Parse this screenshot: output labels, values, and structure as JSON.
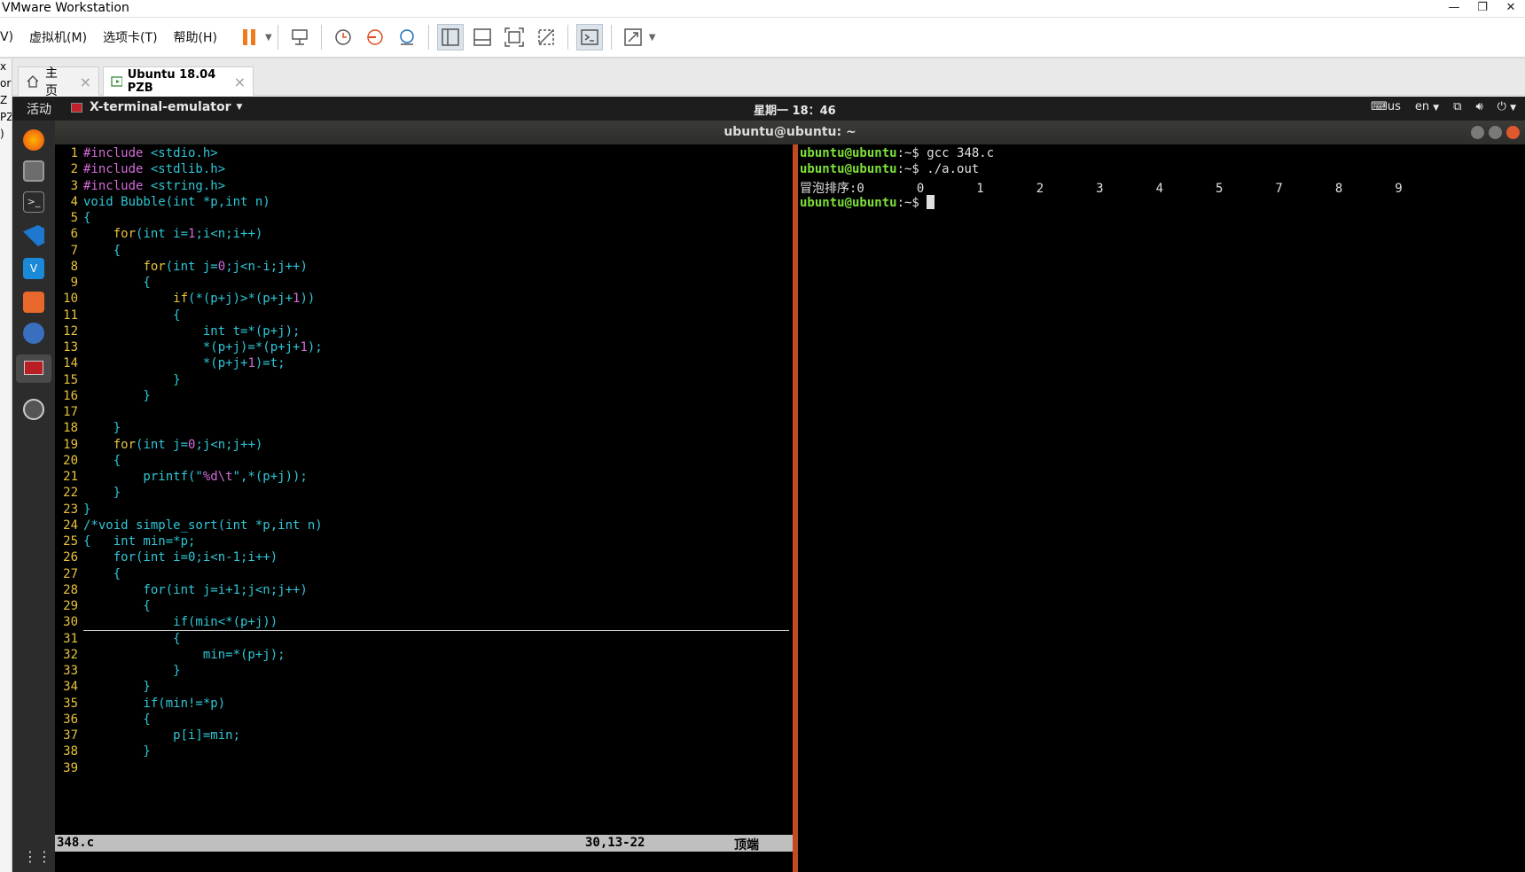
{
  "window": {
    "title": "VMware Workstation"
  },
  "menus": [
    "V)",
    "虚拟机(M)",
    "选项卡(T)",
    "帮助(H)"
  ],
  "left_strip": [
    "x",
    "",
    "",
    "",
    "",
    "or",
    "Z",
    "PZ",
    ")"
  ],
  "tabs": [
    {
      "label": "主页",
      "icon": "home-icon"
    },
    {
      "label": "Ubuntu 18.04 PZB",
      "icon": "vm-icon"
    }
  ],
  "ubuntu": {
    "activities": "活动",
    "app_name": "X-terminal-emulator",
    "clock": "星期一 18：46",
    "keyboard": "us",
    "lang": "en",
    "terminal_title": "ubuntu@ubuntu: ~"
  },
  "dock": [
    "firefox-icon",
    "files-icon",
    "terminal-icon",
    "vscode-icon",
    "vmware-icon",
    "software-icon",
    "settings-icon",
    "terminal-emulator-icon",
    "update-icon",
    "apps-grid-icon"
  ],
  "vim": {
    "line_numbers": [
      "1",
      "2",
      "3",
      "4",
      "5",
      "6",
      "7",
      "8",
      "9",
      "10",
      "11",
      "12",
      "13",
      "14",
      "15",
      "16",
      "17",
      "18",
      "19",
      "20",
      "21",
      "22",
      "23",
      "24",
      "25",
      "26",
      "27",
      "28",
      "29",
      "30",
      "31",
      "32",
      "33",
      "34",
      "35",
      "36",
      "37",
      "38",
      "39"
    ],
    "lines": [
      [
        [
          "m",
          "#include "
        ],
        [
          "c",
          "<stdio.h>"
        ]
      ],
      [
        [
          "m",
          "#include "
        ],
        [
          "c",
          "<stdlib.h>"
        ]
      ],
      [
        [
          "m",
          "#include "
        ],
        [
          "c",
          "<string.h>"
        ]
      ],
      [
        [
          "c",
          "void Bubble(int *p,int n)"
        ]
      ],
      [
        [
          "c",
          "{"
        ]
      ],
      [
        [
          "c",
          "    "
        ],
        [
          "y",
          "for"
        ],
        [
          "c",
          "(int i="
        ],
        [
          "m",
          "1"
        ],
        [
          "c",
          ";i<n;i++)"
        ]
      ],
      [
        [
          "c",
          "    {"
        ]
      ],
      [
        [
          "c",
          "        "
        ],
        [
          "y",
          "for"
        ],
        [
          "c",
          "(int j="
        ],
        [
          "m",
          "0"
        ],
        [
          "c",
          ";j<n-i;j++)"
        ]
      ],
      [
        [
          "c",
          "        {"
        ]
      ],
      [
        [
          "c",
          "            "
        ],
        [
          "y",
          "if"
        ],
        [
          "c",
          "(*(p+j)>*(p+j+"
        ],
        [
          "m",
          "1"
        ],
        [
          "c",
          "))"
        ]
      ],
      [
        [
          "c",
          "            {"
        ]
      ],
      [
        [
          "c",
          "                int t=*(p+j);"
        ]
      ],
      [
        [
          "c",
          "                *(p+j)=*(p+j+"
        ],
        [
          "m",
          "1"
        ],
        [
          "c",
          ");"
        ]
      ],
      [
        [
          "c",
          "                *(p+j+"
        ],
        [
          "m",
          "1"
        ],
        [
          "c",
          ")=t;"
        ]
      ],
      [
        [
          "c",
          "            }"
        ]
      ],
      [
        [
          "c",
          "        }"
        ]
      ],
      [
        [
          "c",
          ""
        ]
      ],
      [
        [
          "c",
          "    }"
        ]
      ],
      [
        [
          "c",
          "    "
        ],
        [
          "y",
          "for"
        ],
        [
          "c",
          "(int j="
        ],
        [
          "m",
          "0"
        ],
        [
          "c",
          ";j<n;j++)"
        ]
      ],
      [
        [
          "c",
          "    {"
        ]
      ],
      [
        [
          "c",
          "        printf(\""
        ],
        [
          "m",
          "%d\\t"
        ],
        [
          "c",
          "\",*(p+j));"
        ]
      ],
      [
        [
          "c",
          "    }"
        ]
      ],
      [
        [
          "c",
          "}"
        ]
      ],
      [
        [
          "c",
          "/*void simple_sort(int *p,int n)"
        ]
      ],
      [
        [
          "c",
          "{   int min=*p;"
        ]
      ],
      [
        [
          "c",
          "    for(int i=0;i<n-1;i++)"
        ]
      ],
      [
        [
          "c",
          "    {"
        ]
      ],
      [
        [
          "c",
          "        for(int j=i+1;j<n;j++)"
        ]
      ],
      [
        [
          "c",
          "        {"
        ]
      ],
      [
        [
          "c",
          "            if(min<*(p+j))"
        ]
      ],
      [
        [
          "c",
          "            {"
        ]
      ],
      [
        [
          "c",
          "                min=*(p+j);"
        ]
      ],
      [
        [
          "c",
          "            }"
        ]
      ],
      [
        [
          "c",
          "        }"
        ]
      ],
      [
        [
          "c",
          "        if(min!=*p)"
        ]
      ],
      [
        [
          "c",
          "        {"
        ]
      ],
      [
        [
          "c",
          "            p[i]=min;"
        ]
      ],
      [
        [
          "c",
          "        }"
        ]
      ],
      [
        [
          "c",
          ""
        ]
      ]
    ],
    "status": {
      "filename": "348.c",
      "position": "30,13-22",
      "scroll": "顶端"
    }
  },
  "shell": {
    "prompt": "ubuntu@ubuntu",
    "lines": [
      {
        "prompt": "ubuntu@ubuntu",
        "path": ":~$ ",
        "text": "gcc 348.c"
      },
      {
        "prompt": "ubuntu@ubuntu",
        "path": ":~$ ",
        "text": "./a.out"
      },
      {
        "prompt": "",
        "path": "",
        "text": "冒泡排序:0       0       1       2       3       4       5       7       8       9"
      },
      {
        "prompt": "ubuntu@ubuntu",
        "path": ":~$ ",
        "text": ""
      }
    ]
  }
}
